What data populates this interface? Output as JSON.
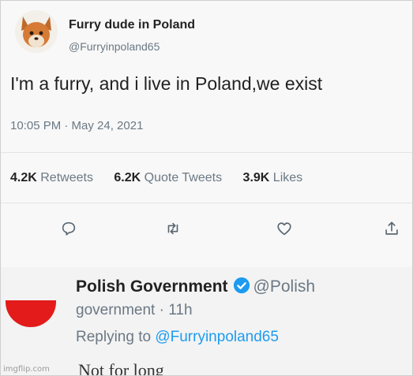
{
  "tweet": {
    "display_name": "Furry dude in Poland",
    "handle": "@Furryinpoland65",
    "text": "I'm a furry, and i live in Poland,we exist",
    "timestamp": "10:05 PM · May 24, 2021",
    "stats": {
      "retweets_count": "4.2K",
      "retweets_label": "Retweets",
      "quote_count": "6.2K",
      "quote_label": "Quote Tweets",
      "likes_count": "3.9K",
      "likes_label": "Likes"
    },
    "actions": {
      "reply_icon": "comment-icon",
      "retweet_icon": "retweet-icon",
      "like_icon": "heart-icon",
      "share_icon": "share-icon"
    }
  },
  "reply": {
    "display_name": "Polish Government",
    "handle_part1": "@Polish",
    "handle_part2": "government",
    "time": "· 11h",
    "replying_prefix": "Replying to",
    "replying_mention": "@Furryinpoland65",
    "text": "Not for long"
  },
  "watermark": "imgflip.com",
  "colors": {
    "accent": "#1d9bf0",
    "flag_red": "#e31b1b",
    "secondary_text": "#6b7884"
  }
}
